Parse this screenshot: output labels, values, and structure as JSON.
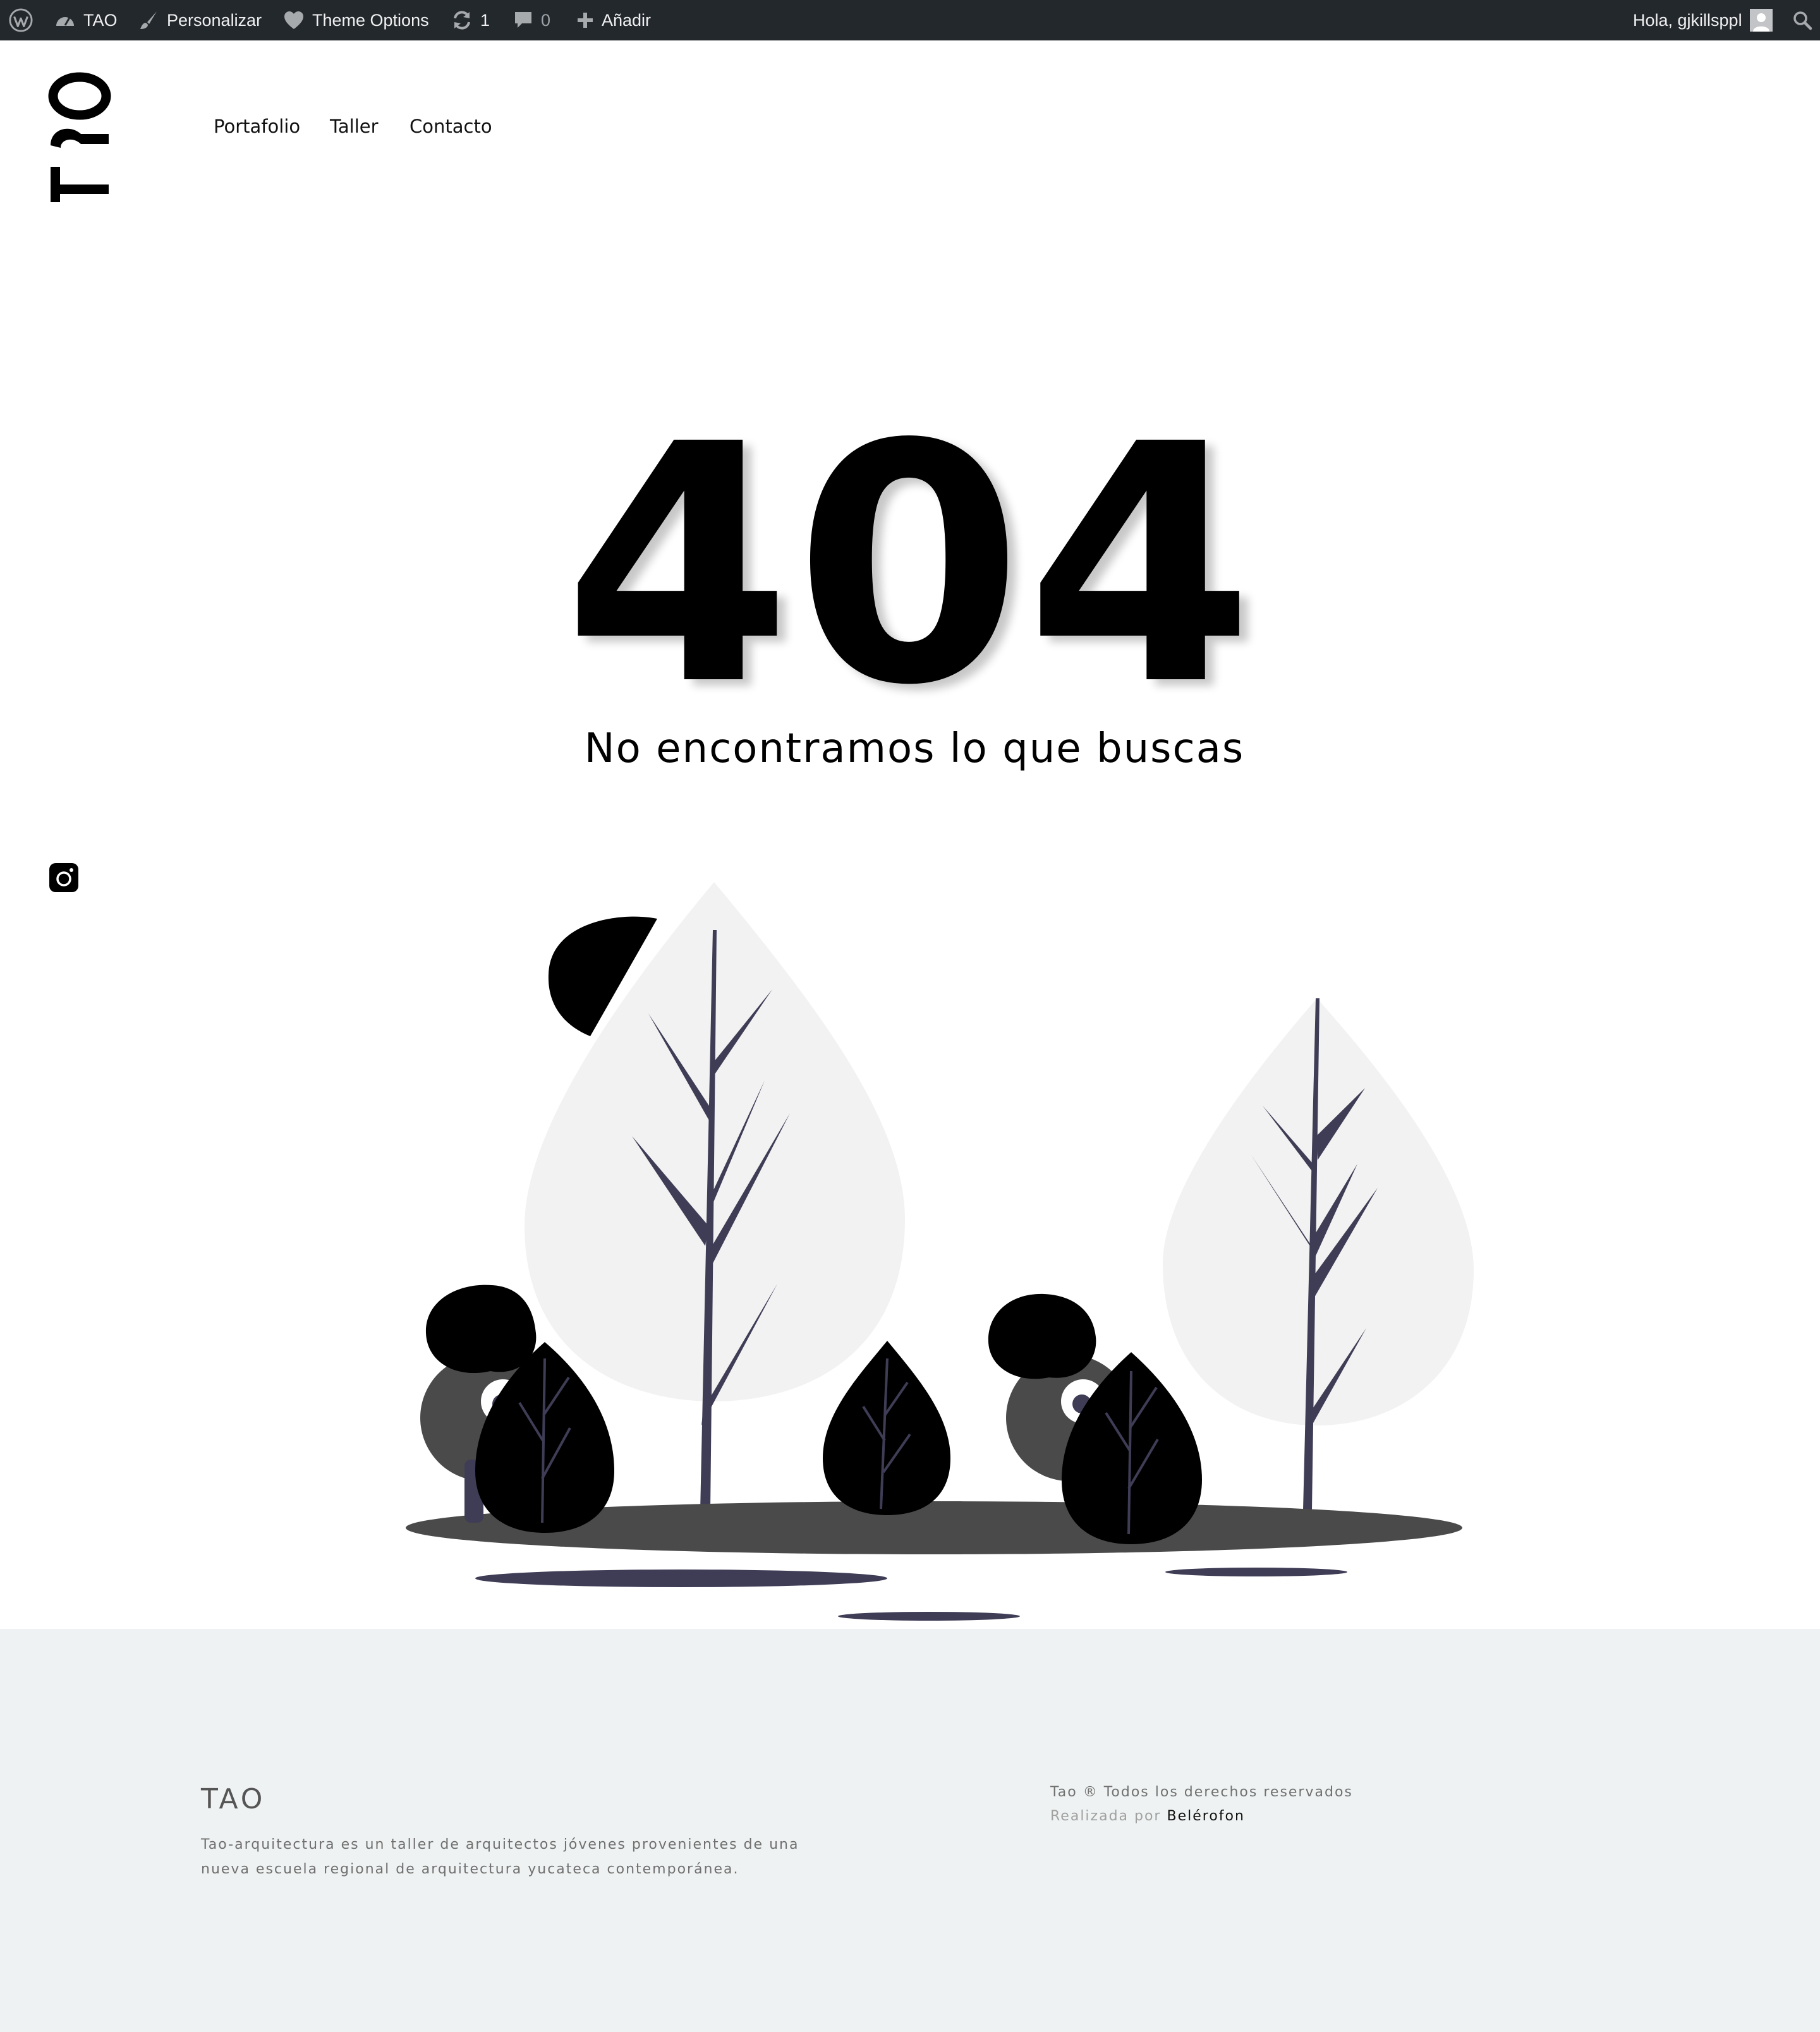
{
  "admin_bar": {
    "site_name": "TAO",
    "customize_label": "Personalizar",
    "theme_options_label": "Theme Options",
    "updates_count": "1",
    "comments_count": "0",
    "add_new_label": "Añadir",
    "greeting": "Hola, gjkillsppl",
    "colors": {
      "background": "#23282d",
      "text": "#f0f0f1"
    },
    "icons": [
      "wordpress-icon",
      "dashboard-icon",
      "brush-icon",
      "heart-icon",
      "updates-icon",
      "comment-icon",
      "plus-icon",
      "avatar",
      "search-icon"
    ]
  },
  "header": {
    "logo_text": "TAO",
    "nav": {
      "items": [
        {
          "label": "Portafolio"
        },
        {
          "label": "Taller"
        },
        {
          "label": "Contacto"
        }
      ]
    }
  },
  "error": {
    "code": "404",
    "message": "No encontramos lo que buscas"
  },
  "social": {
    "icon": "instagram-icon"
  },
  "footer": {
    "brand": "TAO",
    "description": "Tao-arquitectura es un taller de arquitectos jóvenes provenientes de una nueva escuela regional de arquitectura yucateca contemporánea.",
    "copyright": "Tao ® Todos los derechos reservados",
    "credit_prefix": "Realizada por",
    "credit_link": "Belérofon",
    "colors": {
      "background": "#eff2f2",
      "text": "#707070"
    }
  },
  "colors": {
    "tree_trunk": "#3f3d56",
    "tree_canopy": "#f2f2f2",
    "ground": "#4a4a4a",
    "accent_black": "#000000"
  }
}
